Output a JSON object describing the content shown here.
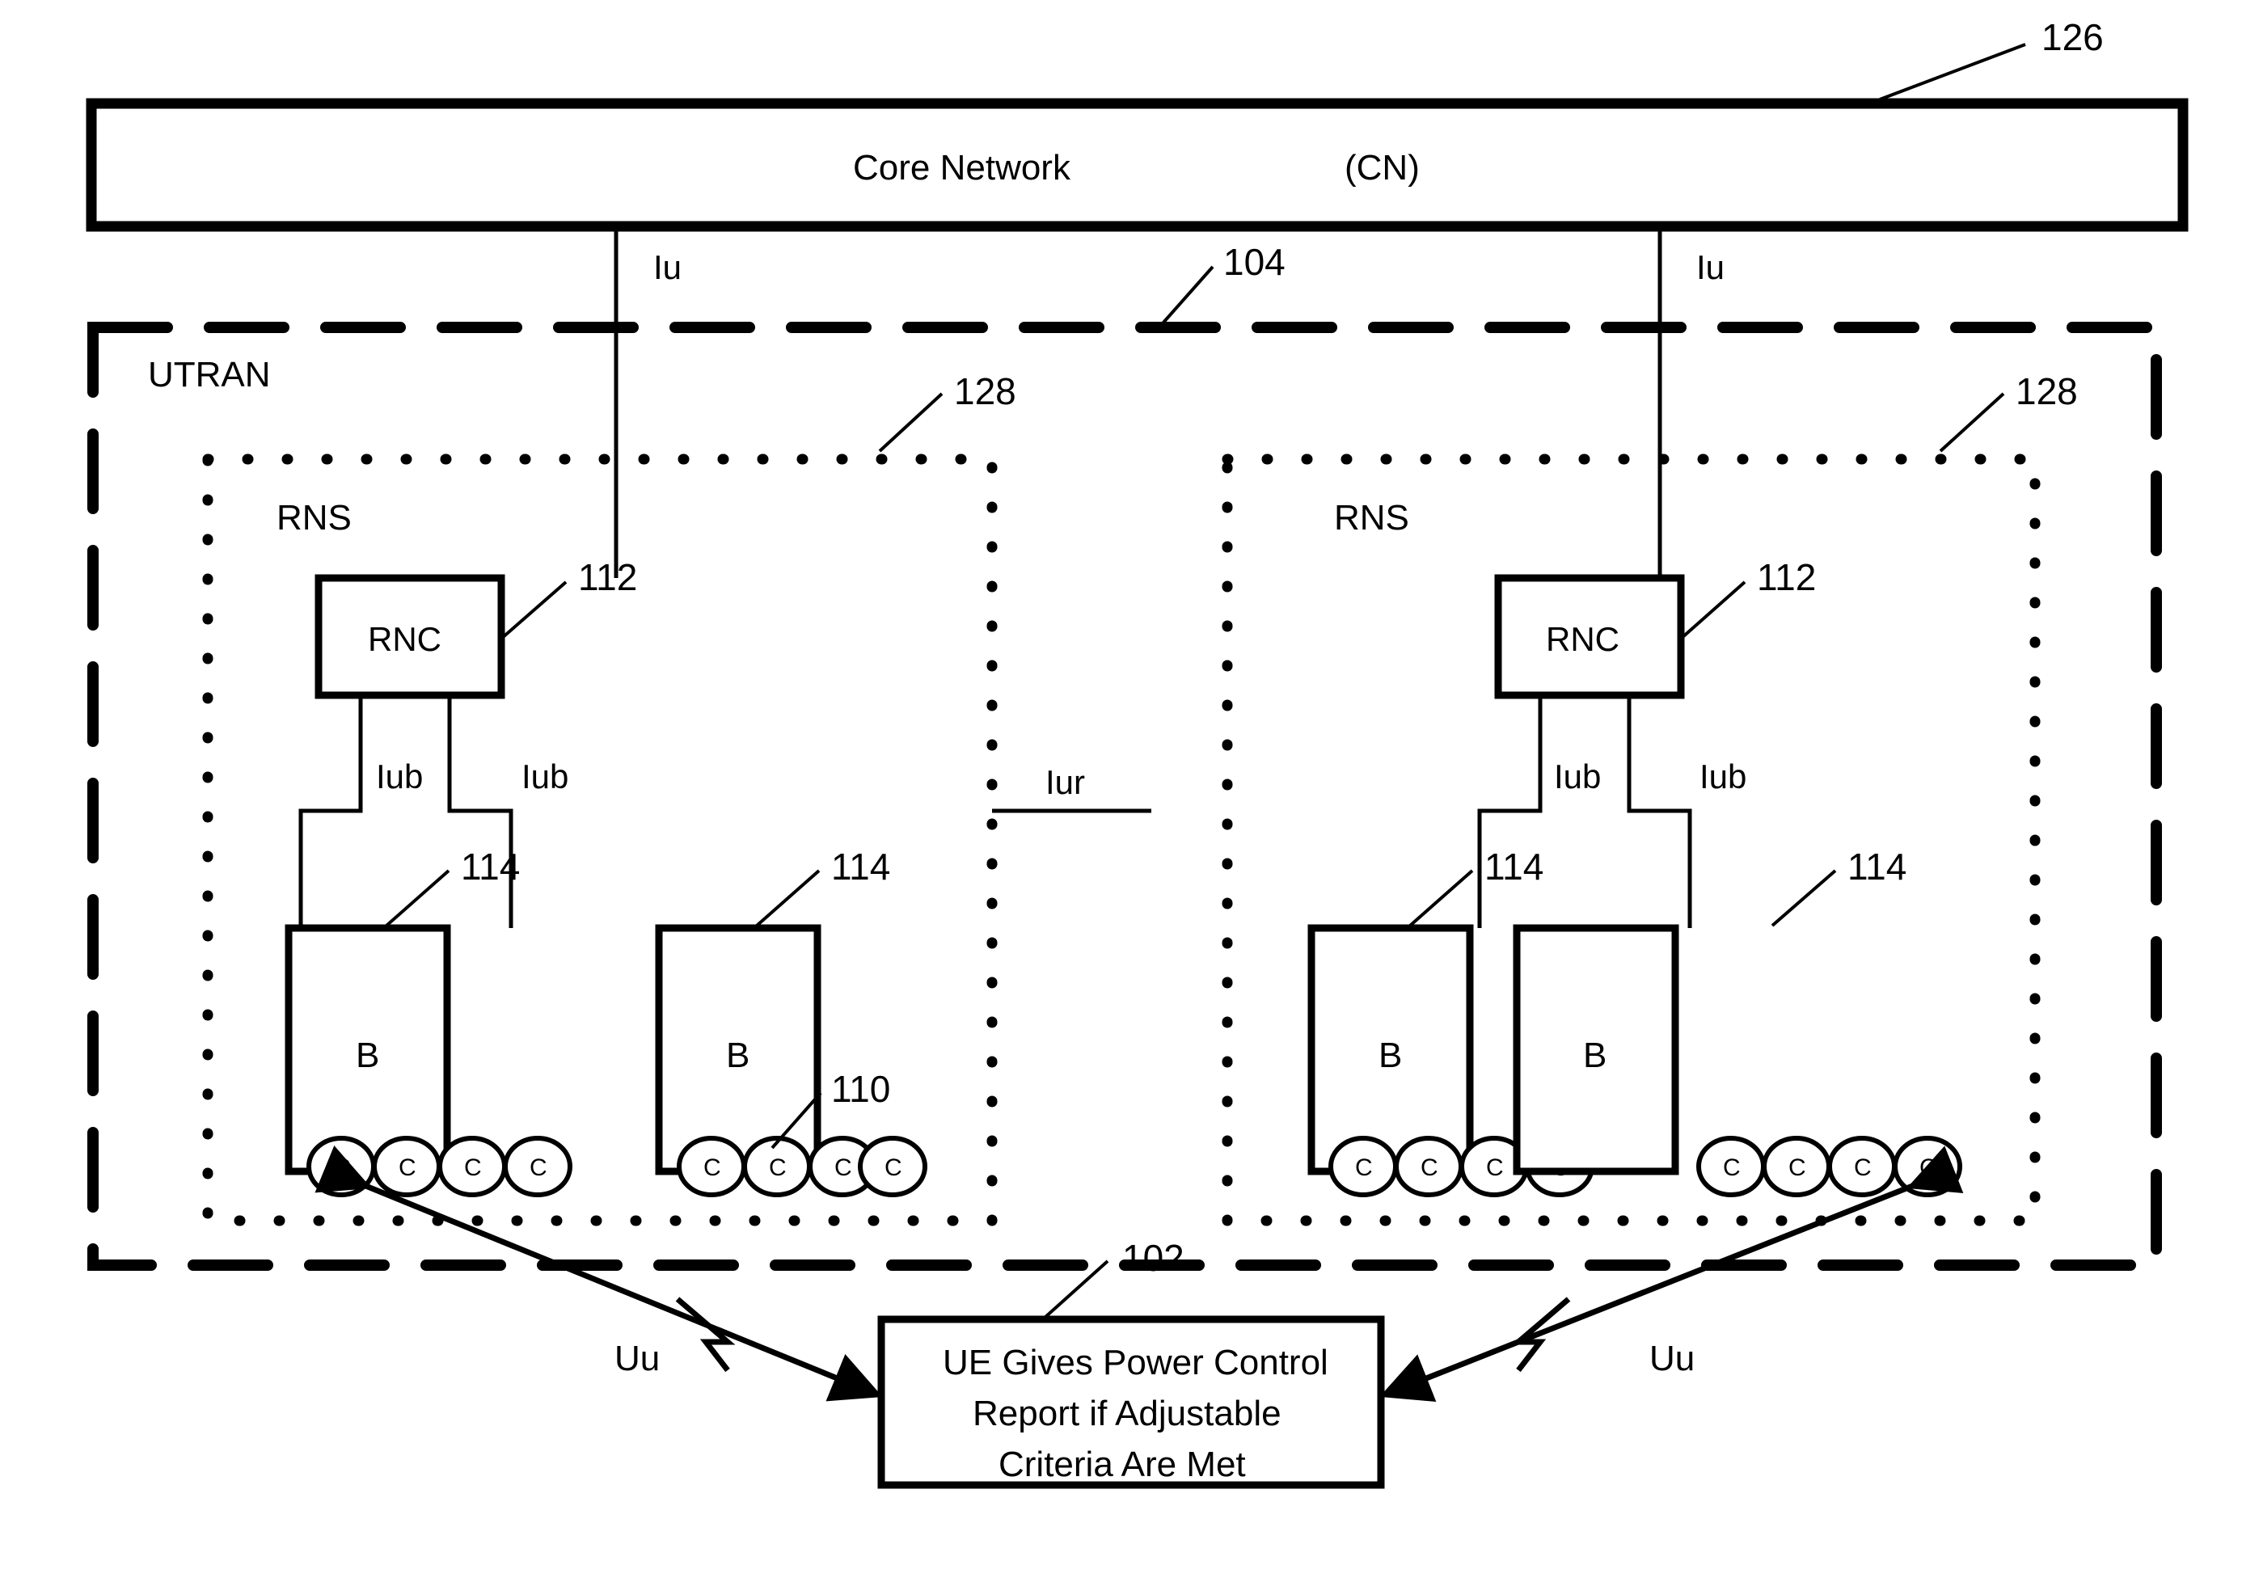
{
  "diagram": {
    "title_core_network": "Core Network",
    "core_network_abbrev": "(CN)",
    "utran_label": "UTRAN",
    "ref_core_network": "126",
    "ref_utran": "104",
    "ref_rns": "128",
    "ref_rnc": "112",
    "ref_nodeb": "114",
    "ref_cell": "110",
    "ref_ue": "102",
    "iface_iu": "Iu",
    "iface_iub": "Iub",
    "iface_iur": "Iur",
    "iface_uu": "Uu",
    "rns_label": "RNS",
    "rnc_label": "RNC",
    "nodeb_label": "B",
    "cell_label": "C",
    "ue_line1": "UE Gives Power Control",
    "ue_line2": "Report if Adjustable",
    "ue_line3": "Criteria Are Met",
    "colors": {
      "stroke": "#000000",
      "fill": "#ffffff"
    }
  }
}
